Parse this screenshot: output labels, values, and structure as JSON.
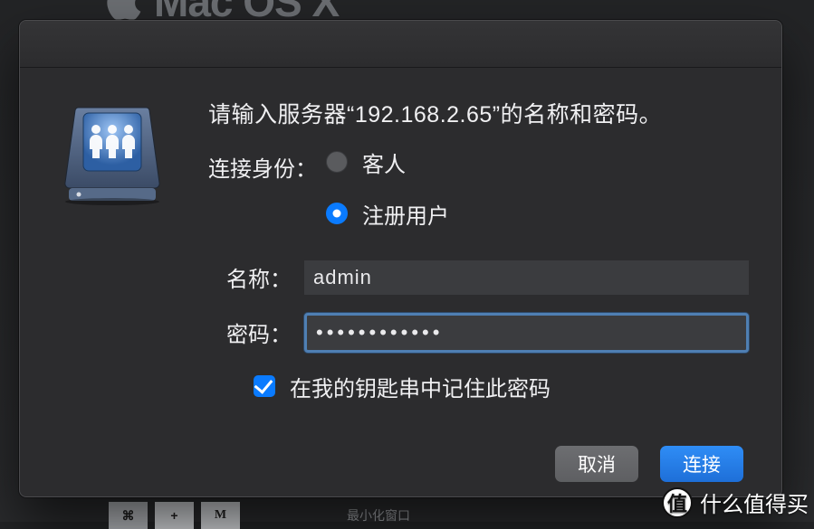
{
  "background": {
    "header_text": "Mac OS X",
    "toolbar_plus": "+",
    "toolbar_m": "M",
    "bottom_label": "最小化窗口"
  },
  "dialog": {
    "prompt": "请输入服务器“192.168.2.65”的名称和密码。",
    "identity_label": "连接身份：",
    "radio_guest": "客人",
    "radio_registered": "注册用户",
    "name_label": "名称：",
    "name_value": "admin",
    "password_label": "密码：",
    "password_value": "●●●●●●●●●●●●",
    "remember_label": "在我的钥匙串中记住此密码",
    "cancel": "取消",
    "connect": "连接"
  },
  "watermark": {
    "badge": "值",
    "text": "什么值得买"
  }
}
